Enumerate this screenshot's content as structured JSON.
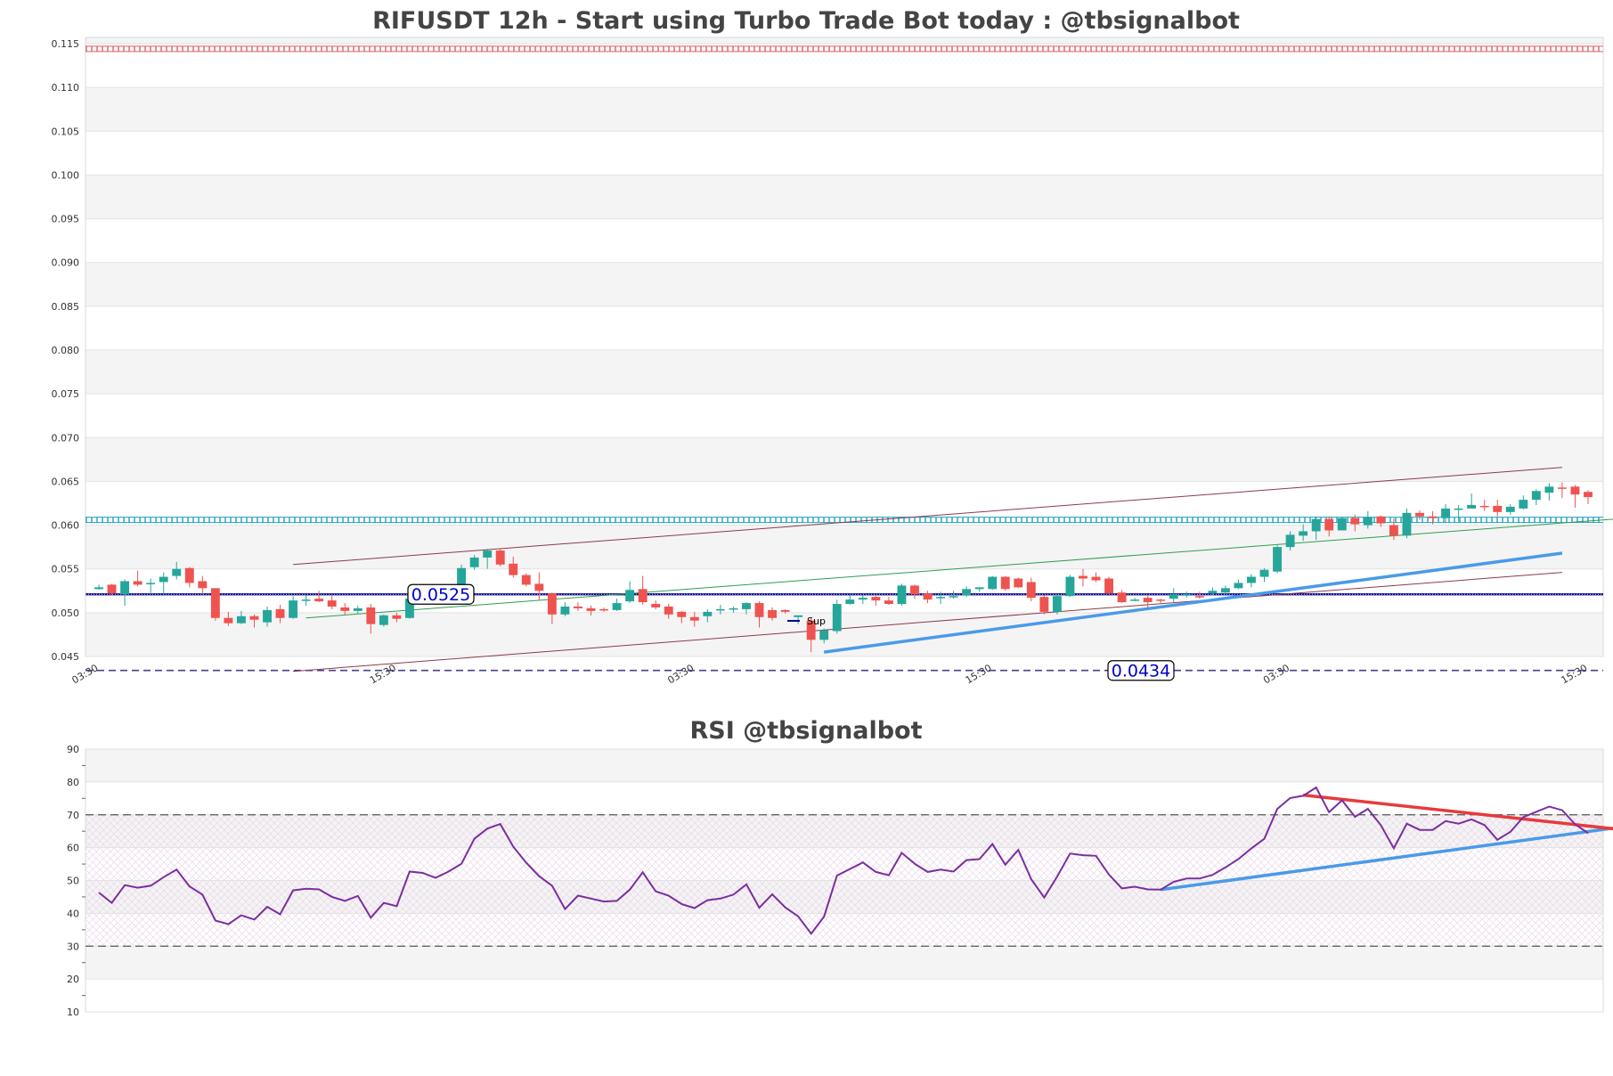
{
  "chart_data": [
    {
      "type": "candlestick",
      "title": "RIFUSDT 12h - Start using Turbo Trade Bot today : @tbsignalbot",
      "ylim": [
        0.045,
        0.115
      ],
      "yticks": [
        "0.045",
        "0.050",
        "0.055",
        "0.060",
        "0.065",
        "0.070",
        "0.075",
        "0.080",
        "0.085",
        "0.090",
        "0.095",
        "0.100",
        "0.105",
        "0.110",
        "0.115"
      ],
      "xtick_labels": [
        "03:30",
        "15:30",
        "03:30",
        "15:30",
        "03:30",
        "15:30"
      ],
      "xtick_index": [
        0,
        23,
        46,
        69,
        92,
        115
      ],
      "colors": {
        "up": "#26a69a",
        "down": "#ef5350",
        "support": "#00008b",
        "resistance_zone": "#e06060",
        "mid_zone": "#20a0c0",
        "channel": "#8b3a4a",
        "green_line": "#2e9e4e",
        "trend": "#4a9ae8"
      },
      "candles": [
        [
          0.0527,
          0.0532,
          0.0529,
          0.0526
        ],
        [
          0.0532,
          0.0533,
          0.0522,
          0.052
        ],
        [
          0.0521,
          0.0538,
          0.0536,
          0.0508
        ],
        [
          0.0536,
          0.0548,
          0.0532,
          0.053
        ],
        [
          0.0533,
          0.0539,
          0.0534,
          0.0521
        ],
        [
          0.0535,
          0.0546,
          0.0541,
          0.0521
        ],
        [
          0.0542,
          0.0558,
          0.055,
          0.0538
        ],
        [
          0.0551,
          0.0552,
          0.0534,
          0.0529
        ],
        [
          0.0536,
          0.0542,
          0.0528,
          0.0521
        ],
        [
          0.0528,
          0.0528,
          0.0494,
          0.0491
        ],
        [
          0.0494,
          0.0501,
          0.0488,
          0.0485
        ],
        [
          0.0488,
          0.0502,
          0.0496,
          0.0487
        ],
        [
          0.0496,
          0.0498,
          0.0492,
          0.0483
        ],
        [
          0.0489,
          0.0507,
          0.0503,
          0.0484
        ],
        [
          0.0504,
          0.0509,
          0.0494,
          0.0488
        ],
        [
          0.0494,
          0.0519,
          0.0514,
          0.0493
        ],
        [
          0.0514,
          0.052,
          0.0515,
          0.0508
        ],
        [
          0.0516,
          0.0525,
          0.0513,
          0.0512
        ],
        [
          0.0514,
          0.0521,
          0.0507,
          0.0504
        ],
        [
          0.0506,
          0.0511,
          0.0502,
          0.0497
        ],
        [
          0.0502,
          0.0508,
          0.0505,
          0.0499
        ],
        [
          0.0506,
          0.051,
          0.0487,
          0.0476
        ],
        [
          0.0486,
          0.0498,
          0.0497,
          0.0484
        ],
        [
          0.0497,
          0.05,
          0.0493,
          0.0489
        ],
        [
          0.0494,
          0.0524,
          0.0516,
          0.0493
        ],
        [
          0.0516,
          0.0529,
          0.0521,
          0.0517
        ],
        [
          0.0521,
          0.053,
          0.0527,
          0.0517
        ],
        [
          0.0527,
          0.0529,
          0.0527,
          0.052
        ],
        [
          0.0528,
          0.0555,
          0.0551,
          0.0527
        ],
        [
          0.0552,
          0.0566,
          0.0563,
          0.0549
        ],
        [
          0.0563,
          0.0573,
          0.0571,
          0.055
        ],
        [
          0.0571,
          0.0573,
          0.0555,
          0.0553
        ],
        [
          0.0556,
          0.0564,
          0.0543,
          0.054
        ],
        [
          0.0543,
          0.0545,
          0.0532,
          0.053
        ],
        [
          0.0533,
          0.0546,
          0.0525,
          0.0514
        ],
        [
          0.0522,
          0.0523,
          0.0498,
          0.0487
        ],
        [
          0.0498,
          0.0512,
          0.0507,
          0.0496
        ],
        [
          0.0507,
          0.0512,
          0.0505,
          0.0502
        ],
        [
          0.0505,
          0.0508,
          0.0502,
          0.0497
        ],
        [
          0.0504,
          0.0506,
          0.0503,
          0.0501
        ],
        [
          0.0503,
          0.0516,
          0.0511,
          0.0502
        ],
        [
          0.0513,
          0.0536,
          0.0526,
          0.0511
        ],
        [
          0.0527,
          0.0542,
          0.0512,
          0.0509
        ],
        [
          0.051,
          0.0514,
          0.0506,
          0.0504
        ],
        [
          0.0507,
          0.051,
          0.0498,
          0.0493
        ],
        [
          0.0501,
          0.0502,
          0.0495,
          0.0488
        ],
        [
          0.0495,
          0.0501,
          0.0491,
          0.0484
        ],
        [
          0.0496,
          0.0504,
          0.0501,
          0.0489
        ],
        [
          0.0504,
          0.0509,
          0.0504,
          0.0498
        ],
        [
          0.0505,
          0.0507,
          0.0505,
          0.05
        ],
        [
          0.0504,
          0.0512,
          0.0511,
          0.0498
        ],
        [
          0.0511,
          0.0513,
          0.0495,
          0.0483
        ],
        [
          0.0503,
          0.0506,
          0.0494,
          0.0491
        ],
        [
          0.0503,
          0.0504,
          0.0501,
          0.0499
        ],
        [
          0.0495,
          0.0495,
          0.0497,
          0.0487
        ],
        [
          0.0491,
          0.0494,
          0.0469,
          0.0455
        ],
        [
          0.0469,
          0.0482,
          0.048,
          0.0465
        ],
        [
          0.0479,
          0.0515,
          0.051,
          0.0476
        ],
        [
          0.051,
          0.052,
          0.0515,
          0.0509
        ],
        [
          0.0515,
          0.052,
          0.0517,
          0.051
        ],
        [
          0.0518,
          0.0519,
          0.0514,
          0.0508
        ],
        [
          0.0514,
          0.0518,
          0.051,
          0.0509
        ],
        [
          0.051,
          0.0533,
          0.0531,
          0.0508
        ],
        [
          0.0531,
          0.0532,
          0.0521,
          0.0516
        ],
        [
          0.0522,
          0.0525,
          0.0515,
          0.0511
        ],
        [
          0.0517,
          0.0524,
          0.0518,
          0.051
        ],
        [
          0.0518,
          0.0525,
          0.0519,
          0.0516
        ],
        [
          0.052,
          0.053,
          0.0527,
          0.0518
        ],
        [
          0.0527,
          0.0529,
          0.0529,
          0.0524
        ],
        [
          0.0527,
          0.0542,
          0.0541,
          0.0526
        ],
        [
          0.0541,
          0.0542,
          0.0527,
          0.0525
        ],
        [
          0.0539,
          0.054,
          0.0529,
          0.0528
        ],
        [
          0.0535,
          0.054,
          0.0517,
          0.0513
        ],
        [
          0.0518,
          0.052,
          0.0501,
          0.0498
        ],
        [
          0.0501,
          0.0521,
          0.0519,
          0.0498
        ],
        [
          0.0519,
          0.0543,
          0.0541,
          0.0518
        ],
        [
          0.0542,
          0.055,
          0.0539,
          0.053
        ],
        [
          0.0541,
          0.0546,
          0.0537,
          0.0535
        ],
        [
          0.0539,
          0.0541,
          0.0522,
          0.0521
        ],
        [
          0.0523,
          0.0526,
          0.0512,
          0.0511
        ],
        [
          0.0515,
          0.0517,
          0.0515,
          0.0513
        ],
        [
          0.0517,
          0.0519,
          0.0512,
          0.0506
        ],
        [
          0.0515,
          0.0516,
          0.0514,
          0.0511
        ],
        [
          0.0516,
          0.0528,
          0.0521,
          0.0512
        ],
        [
          0.0521,
          0.0524,
          0.0521,
          0.0517
        ],
        [
          0.0519,
          0.0524,
          0.0518,
          0.0516
        ],
        [
          0.0522,
          0.0529,
          0.0525,
          0.052
        ],
        [
          0.0523,
          0.0531,
          0.0528,
          0.0521
        ],
        [
          0.0528,
          0.0538,
          0.0534,
          0.0527
        ],
        [
          0.0534,
          0.0544,
          0.0541,
          0.0529
        ],
        [
          0.0541,
          0.0551,
          0.0549,
          0.0535
        ],
        [
          0.0547,
          0.0577,
          0.0575,
          0.0545
        ],
        [
          0.0575,
          0.0593,
          0.0589,
          0.0571
        ],
        [
          0.0588,
          0.0601,
          0.0593,
          0.0582
        ],
        [
          0.0593,
          0.061,
          0.0607,
          0.0583
        ],
        [
          0.0607,
          0.061,
          0.0594,
          0.0587
        ],
        [
          0.0594,
          0.0609,
          0.0608,
          0.0594
        ],
        [
          0.0608,
          0.0612,
          0.0601,
          0.0593
        ],
        [
          0.06,
          0.0616,
          0.0609,
          0.0596
        ],
        [
          0.061,
          0.0611,
          0.0602,
          0.0598
        ],
        [
          0.06,
          0.0608,
          0.0588,
          0.0583
        ],
        [
          0.0588,
          0.0619,
          0.0614,
          0.0585
        ],
        [
          0.0614,
          0.0617,
          0.061,
          0.0606
        ],
        [
          0.061,
          0.0616,
          0.0608,
          0.0601
        ],
        [
          0.0608,
          0.0624,
          0.0619,
          0.0603
        ],
        [
          0.0619,
          0.0623,
          0.0619,
          0.0604
        ],
        [
          0.0619,
          0.0636,
          0.0623,
          0.0619
        ],
        [
          0.0622,
          0.0629,
          0.0621,
          0.0616
        ],
        [
          0.0622,
          0.0629,
          0.0615,
          0.061
        ],
        [
          0.0615,
          0.0624,
          0.0621,
          0.0612
        ],
        [
          0.0619,
          0.0634,
          0.0629,
          0.0618
        ],
        [
          0.0629,
          0.0641,
          0.0639,
          0.0623
        ],
        [
          0.0637,
          0.0648,
          0.0644,
          0.0628
        ],
        [
          0.0643,
          0.0649,
          0.0642,
          0.0631
        ],
        [
          0.0644,
          0.0646,
          0.0635,
          0.062
        ],
        [
          0.0638,
          0.064,
          0.0632,
          0.0624
        ]
      ],
      "support": {
        "label": "0.0525",
        "value": 0.0521
      },
      "lower_level": {
        "label": "0.0434",
        "value": 0.0434
      },
      "resistance_zone": 0.1144,
      "mid_zone": 0.0606,
      "legend": "Sup",
      "channel_upper": [
        [
          15,
          0.0555
        ],
        [
          113,
          0.0666
        ]
      ],
      "channel_lower": [
        [
          15,
          0.0433
        ],
        [
          113,
          0.0546
        ]
      ],
      "green_line": [
        [
          16,
          0.0494
        ],
        [
          118,
          0.0608
        ]
      ],
      "trend_line": [
        [
          56,
          0.0455
        ],
        [
          113,
          0.0568
        ]
      ]
    },
    {
      "type": "line",
      "title": "RSI @tbsignalbot",
      "ylim": [
        10,
        90
      ],
      "yticks": [
        "10",
        "20",
        "30",
        "40",
        "50",
        "60",
        "70",
        "80",
        "90"
      ],
      "levels": [
        30,
        70
      ],
      "values": [
        46.3,
        43.2,
        48.6,
        47.8,
        48.4,
        51.0,
        53.3,
        48.2,
        45.7,
        37.8,
        36.7,
        39.4,
        38.1,
        42.0,
        39.7,
        47.0,
        47.5,
        47.3,
        45.0,
        43.8,
        45.3,
        38.7,
        43.2,
        42.2,
        52.7,
        52.3,
        50.8,
        52.7,
        55.1,
        62.7,
        65.8,
        67.2,
        60.3,
        55.4,
        51.3,
        48.4,
        41.3,
        45.4,
        44.5,
        43.6,
        43.8,
        47.2,
        52.5,
        46.7,
        45.4,
        42.8,
        41.6,
        44.0,
        44.5,
        45.7,
        48.8,
        41.7,
        45.8,
        41.8,
        39.1,
        33.8,
        39.0,
        51.5,
        53.5,
        55.5,
        52.6,
        51.6,
        58.4,
        55.1,
        52.6,
        53.3,
        52.7,
        56.2,
        56.5,
        61.1,
        54.8,
        59.3,
        50.4,
        44.8,
        51.2,
        58.2,
        57.7,
        57.5,
        51.8,
        47.6,
        48.1,
        47.3,
        47.2,
        49.6,
        50.6,
        50.6,
        51.7,
        54.0,
        56.5,
        59.8,
        62.7,
        71.8,
        75.1,
        75.8,
        78.3,
        70.8,
        74.4,
        69.4,
        71.8,
        66.8,
        59.8,
        67.3,
        65.4,
        65.4,
        68.1,
        67.3,
        68.6,
        66.9,
        62.4,
        64.8,
        69.3,
        70.9,
        72.5,
        71.4,
        67.1,
        64.4
      ],
      "trend_up": [
        [
          82,
          47.2
        ],
        [
          118,
          66.5
        ]
      ],
      "trend_down": [
        [
          93,
          76.0
        ],
        [
          118,
          65.3
        ]
      ]
    }
  ]
}
